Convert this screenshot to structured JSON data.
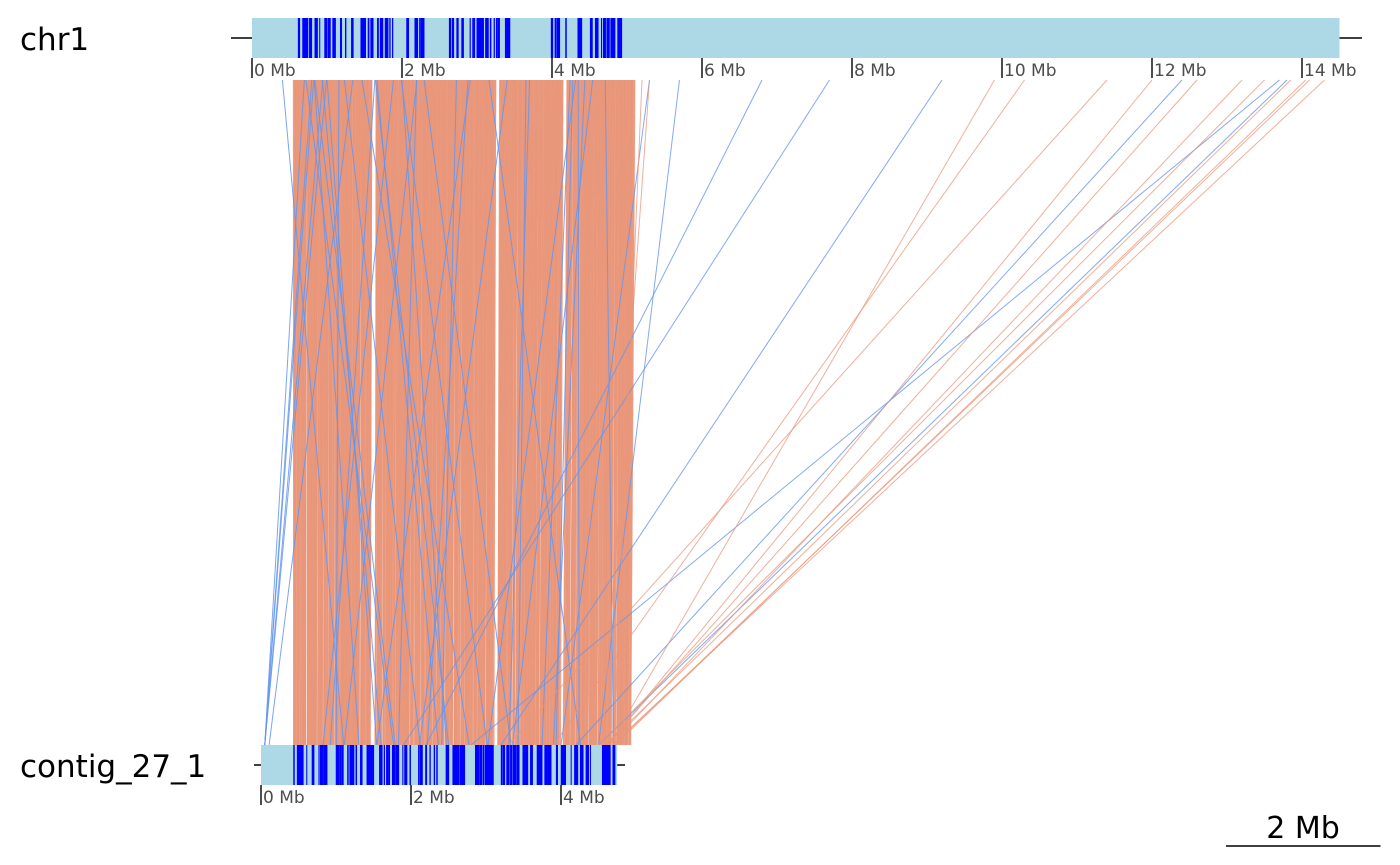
{
  "genomes": {
    "reference": {
      "name": "chr1",
      "length_mb": 14.5,
      "ticks": [
        {
          "mb": 0,
          "label": "0 Mb"
        },
        {
          "mb": 2,
          "label": "2 Mb"
        },
        {
          "mb": 4,
          "label": "4 Mb"
        },
        {
          "mb": 6,
          "label": "6 Mb"
        },
        {
          "mb": 8,
          "label": "8 Mb"
        },
        {
          "mb": 10,
          "label": "10 Mb"
        },
        {
          "mb": 12,
          "label": "12 Mb"
        },
        {
          "mb": 14,
          "label": "14 Mb"
        }
      ]
    },
    "query": {
      "name": "contig_27_1",
      "length_mb": 4.75,
      "ticks": [
        {
          "mb": 0,
          "label": "0 Mb"
        },
        {
          "mb": 2,
          "label": "2 Mb"
        },
        {
          "mb": 4,
          "label": "4 Mb"
        }
      ]
    }
  },
  "scale_bar": {
    "label": "2 Mb",
    "mb": 2
  },
  "colors": {
    "bar_fill": "#add8e6",
    "marker": "#0000ff",
    "forward_link": "#e9967a",
    "reverse_link": "#6495ed",
    "axis": "#000000",
    "tick": "#4d4d4d"
  }
}
